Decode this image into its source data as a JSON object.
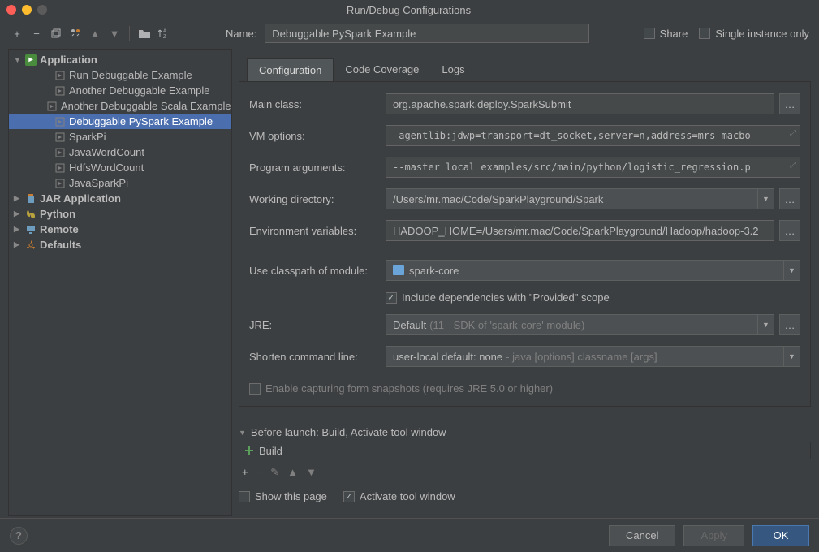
{
  "window": {
    "title": "Run/Debug Configurations"
  },
  "name": {
    "label": "Name:",
    "value": "Debuggable PySpark Example"
  },
  "share": {
    "label": "Share",
    "checked": false
  },
  "singleInstance": {
    "label": "Single instance only",
    "checked": false
  },
  "tree": {
    "nodes": [
      {
        "label": "Application",
        "type": "app",
        "bold": true,
        "caret": "open",
        "indent": 0
      },
      {
        "label": "Run Debuggable Example",
        "type": "cfg",
        "caret": "none",
        "indent": 2
      },
      {
        "label": "Another Debuggable Example",
        "type": "cfg",
        "caret": "none",
        "indent": 2
      },
      {
        "label": "Another Debuggable Scala Example",
        "type": "cfg",
        "caret": "none",
        "indent": 2
      },
      {
        "label": "Debuggable PySpark Example",
        "type": "cfg",
        "caret": "none",
        "indent": 2,
        "selected": true
      },
      {
        "label": "SparkPi",
        "type": "cfg",
        "caret": "none",
        "indent": 2
      },
      {
        "label": "JavaWordCount",
        "type": "cfg",
        "caret": "none",
        "indent": 2
      },
      {
        "label": "HdfsWordCount",
        "type": "cfg",
        "caret": "none",
        "indent": 2
      },
      {
        "label": "JavaSparkPi",
        "type": "cfg",
        "caret": "none",
        "indent": 2
      },
      {
        "label": "JAR Application",
        "type": "jar",
        "bold": true,
        "caret": "closed",
        "indent": 0
      },
      {
        "label": "Python",
        "type": "py",
        "bold": true,
        "caret": "closed",
        "indent": 0
      },
      {
        "label": "Remote",
        "type": "rem",
        "bold": true,
        "caret": "closed",
        "indent": 0
      },
      {
        "label": "Defaults",
        "type": "def",
        "bold": true,
        "caret": "closed",
        "indent": 0
      }
    ]
  },
  "tabs": [
    {
      "label": "Configuration",
      "active": true
    },
    {
      "label": "Code Coverage",
      "active": false
    },
    {
      "label": "Logs",
      "active": false
    }
  ],
  "form": {
    "mainClass": {
      "label": "Main class:",
      "value": "org.apache.spark.deploy.SparkSubmit"
    },
    "vmOptions": {
      "label": "VM options:",
      "value": "-agentlib:jdwp=transport=dt_socket,server=n,address=mrs-macbo"
    },
    "programArgs": {
      "label": "Program arguments:",
      "value": "--master local examples/src/main/python/logistic_regression.p"
    },
    "workingDir": {
      "label": "Working directory:",
      "value": "/Users/mr.mac/Code/SparkPlayground/Spark"
    },
    "envVars": {
      "label": "Environment variables:",
      "value": "HADOOP_HOME=/Users/mr.mac/Code/SparkPlayground/Hadoop/hadoop-3.2"
    },
    "classpath": {
      "label": "Use classpath of module:",
      "value": "spark-core"
    },
    "includeProvided": {
      "label": "Include dependencies with \"Provided\" scope",
      "checked": true
    },
    "jre": {
      "label": "JRE:",
      "value": "Default",
      "hint": "(11 - SDK of 'spark-core' module)"
    },
    "shorten": {
      "label": "Shorten command line:",
      "value": "user-local default: none",
      "hint": "- java [options] classname [args]"
    },
    "enableSnapshot": {
      "label": "Enable capturing form snapshots (requires JRE 5.0 or higher)",
      "checked": false
    }
  },
  "beforeLaunch": {
    "header": "Before launch: Build, Activate tool window",
    "items": [
      {
        "label": "Build"
      }
    ],
    "showThisPage": {
      "label": "Show this page",
      "checked": false
    },
    "activateTool": {
      "label": "Activate tool window",
      "checked": true
    }
  },
  "buttons": {
    "cancel": "Cancel",
    "apply": "Apply",
    "ok": "OK"
  }
}
